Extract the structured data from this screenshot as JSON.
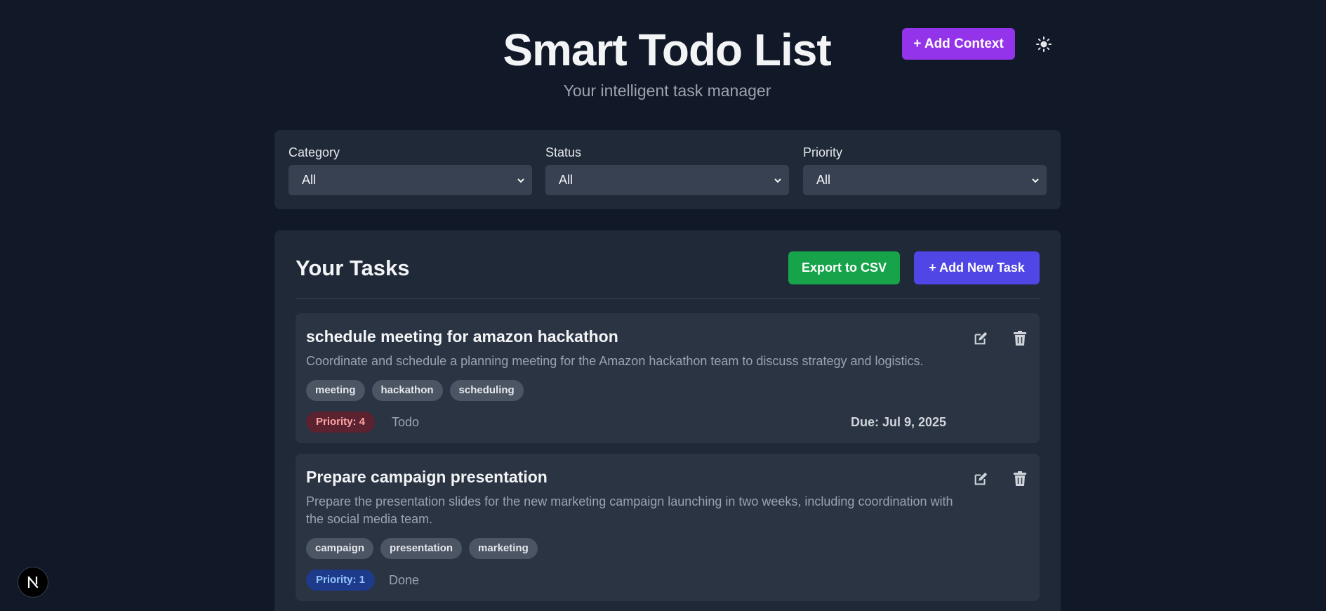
{
  "header": {
    "title": "Smart Todo List",
    "subtitle": "Your intelligent task manager",
    "add_context_label": "+ Add Context",
    "theme_icon": "sun-icon"
  },
  "filters": [
    {
      "label": "Category",
      "value": "All"
    },
    {
      "label": "Status",
      "value": "All"
    },
    {
      "label": "Priority",
      "value": "All"
    }
  ],
  "tasks_panel": {
    "title": "Your Tasks",
    "export_label": "Export to CSV",
    "add_task_label": "+ Add New Task"
  },
  "tasks": [
    {
      "title": "schedule meeting for amazon hackathon",
      "description": "Coordinate and schedule a planning meeting for the Amazon hackathon team to discuss strategy and logistics.",
      "tags": [
        "meeting",
        "hackathon",
        "scheduling"
      ],
      "priority": "Priority: 4",
      "status": "Todo",
      "due": "Due: Jul 9, 2025"
    },
    {
      "title": "Prepare campaign presentation",
      "description": "Prepare the presentation slides for the new marketing campaign launching in two weeks, including coordination with the social media team.",
      "tags": [
        "campaign",
        "presentation",
        "marketing"
      ],
      "priority": "Priority: 1",
      "status": "Done"
    }
  ],
  "colors": {
    "background": "#111827",
    "panel": "#1f2937",
    "add_context": "#9333ea",
    "export": "#16a34a",
    "add_task": "#4f46e5",
    "priority_high_bg": "#5b2230",
    "priority_high_text": "#fca5a5",
    "priority_low_bg": "#1e3a8a",
    "priority_low_text": "#93c5fd"
  }
}
